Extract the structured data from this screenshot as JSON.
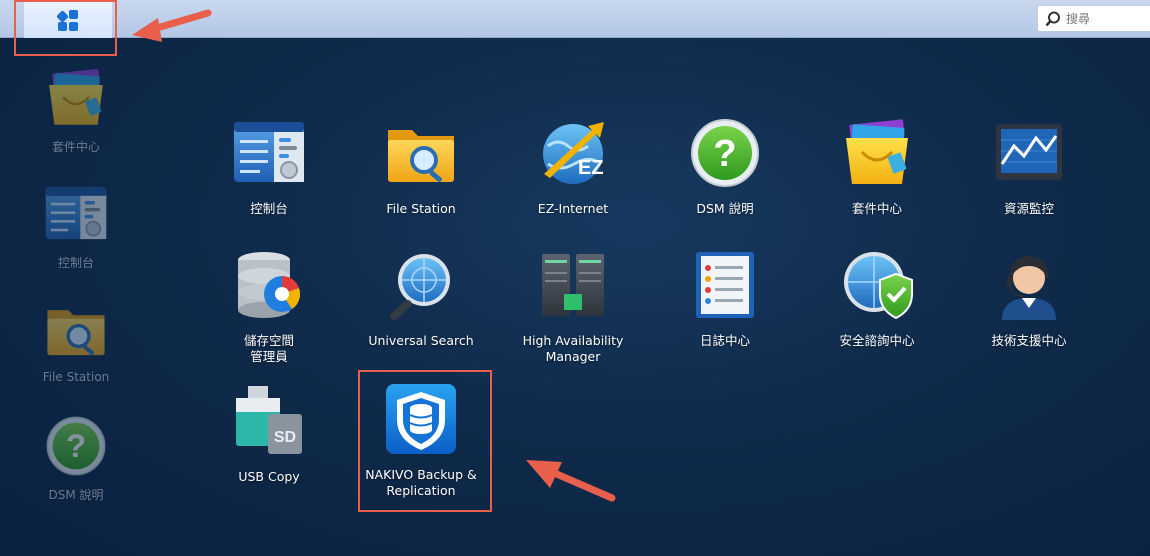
{
  "taskbar": {
    "search_placeholder": "搜尋"
  },
  "desktop_shortcuts": [
    {
      "label": "套件中心",
      "icon": "package-center-icon"
    },
    {
      "label": "控制台",
      "icon": "control-panel-icon"
    },
    {
      "label": "File Station",
      "icon": "file-station-icon"
    },
    {
      "label": "DSM 說明",
      "icon": "dsm-help-icon"
    }
  ],
  "main_menu": {
    "apps": [
      {
        "label": "控制台",
        "icon": "control-panel-icon"
      },
      {
        "label": "File Station",
        "icon": "file-station-icon"
      },
      {
        "label": "EZ-Internet",
        "icon": "ez-internet-icon"
      },
      {
        "label": "DSM 說明",
        "icon": "dsm-help-icon"
      },
      {
        "label": "套件中心",
        "icon": "package-center-icon"
      },
      {
        "label": "資源監控",
        "icon": "resource-monitor-icon"
      },
      {
        "label": "儲存空間\n管理員",
        "icon": "storage-manager-icon"
      },
      {
        "label": "Universal Search",
        "icon": "universal-search-icon"
      },
      {
        "label": "High Availability\nManager",
        "icon": "high-availability-icon"
      },
      {
        "label": "日誌中心",
        "icon": "log-center-icon"
      },
      {
        "label": "安全諮詢中心",
        "icon": "security-advisor-icon"
      },
      {
        "label": "技術支援中心",
        "icon": "support-center-icon"
      },
      {
        "label": "USB Copy",
        "icon": "usb-copy-icon"
      },
      {
        "label": "NAKIVO Backup &\nReplication",
        "icon": "nakivo-icon"
      }
    ]
  },
  "colors": {
    "highlight": "#e8604c",
    "desktop_bg": "#0f2a4a",
    "taskbar_bg": "#c0d2ec"
  }
}
